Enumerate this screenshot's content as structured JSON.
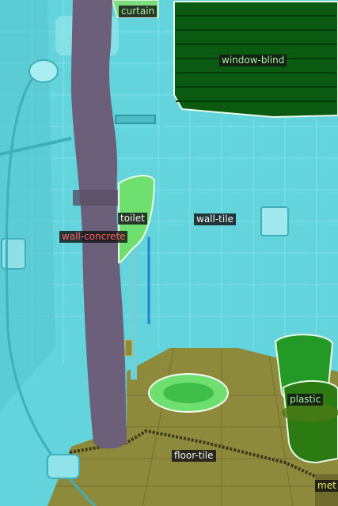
{
  "image": {
    "type": "segmentation-overlay",
    "scene": "bathroom"
  },
  "labels": {
    "curtain": "curtain",
    "window_blind": "window-blind",
    "toilet": "toilet",
    "wall_tile": "wall-tile",
    "wall_concrete": "wall-concrete",
    "plastic": "plastic",
    "floor_tile": "floor-tile",
    "metal": "met"
  },
  "colors": {
    "wall_tile_overlay": "#5fd7df",
    "wall_concrete_overlay": "#6e5f7a",
    "floor_tile_overlay": "#8f8a3a",
    "window_blind_overlay": "#0c5a12",
    "plastic_overlay": "#1f8a1f",
    "toilet_overlay": "#6fe06f",
    "curtain_overlay": "#7ee07e",
    "label_text_green": "#a6f0a6",
    "label_text_red": "#ff6060",
    "label_text_yellow": "#f2e860",
    "label_text_white": "#f4f4f4"
  }
}
